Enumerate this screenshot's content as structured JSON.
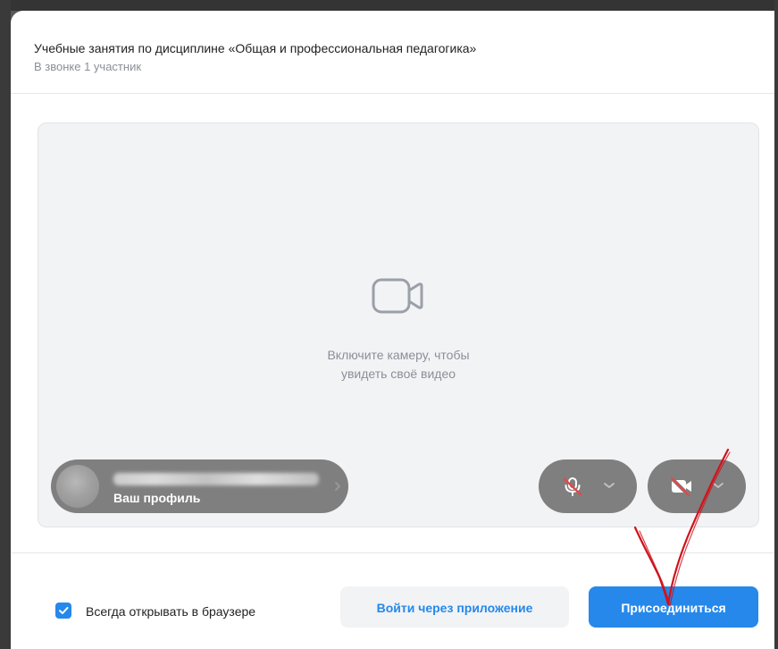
{
  "header": {
    "title": "Учебные занятия по дисциплине «Общая и профессиональная педагогика»",
    "participants": "В звонке 1 участник"
  },
  "preview": {
    "camera_hint_line1": "Включите камеру, чтобы",
    "camera_hint_line2": "увидеть своё видео",
    "profile_label": "Ваш профиль"
  },
  "controls": {
    "microphone": {
      "icon": "mic-off-icon",
      "state": "off"
    },
    "camera": {
      "icon": "camera-off-icon",
      "state": "off"
    }
  },
  "footer": {
    "checkbox_label": "Всегда открывать в браузере",
    "checkbox_checked": true,
    "open_in_app_label": "Войти через приложение",
    "join_label": "Присоединиться"
  },
  "colors": {
    "accent": "#2688eb",
    "pill_background": "#7f7f7f",
    "preview_background": "#f2f3f5",
    "annotation_red": "#d0121b"
  }
}
